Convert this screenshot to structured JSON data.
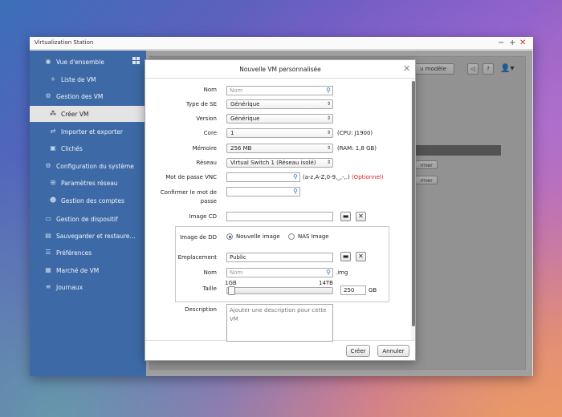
{
  "window": {
    "title": "Virtualization Station"
  },
  "sidebar": {
    "items": [
      {
        "label": "Vue d'ensemble",
        "icon": "circle-info-icon"
      },
      {
        "label": "Liste de VM",
        "icon": "plus-icon"
      },
      {
        "label": "Gestion des VM",
        "icon": "gear-icon"
      },
      {
        "label": "Créer VM",
        "icon": "cluster-icon"
      },
      {
        "label": "Importer et exporter",
        "icon": "import-export-icon"
      },
      {
        "label": "Clichés",
        "icon": "camera-icon"
      },
      {
        "label": "Configuration du système",
        "icon": "settings-icon"
      },
      {
        "label": "Paramètres réseau",
        "icon": "network-icon"
      },
      {
        "label": "Gestion des comptes",
        "icon": "users-icon"
      },
      {
        "label": "Gestion de dispositif",
        "icon": "device-icon"
      },
      {
        "label": "Sauvegarder et restaure...",
        "icon": "backup-icon"
      },
      {
        "label": "Préférences",
        "icon": "preferences-icon"
      },
      {
        "label": "Marché de VM",
        "icon": "market-icon"
      },
      {
        "label": "Journaux",
        "icon": "log-icon"
      }
    ],
    "active_index": 3
  },
  "main": {
    "template_button": "u modèle",
    "fragment_button": "rmer"
  },
  "dialog": {
    "title": "Nouvelle VM personnalisée",
    "fields": {
      "nom": {
        "label": "Nom",
        "placeholder": "Nom"
      },
      "type_se": {
        "label": "Type de SE",
        "value": "Générique"
      },
      "version": {
        "label": "Version",
        "value": "Générique"
      },
      "core": {
        "label": "Core",
        "value": "1",
        "note": "(CPU: J1900)"
      },
      "memoire": {
        "label": "Mémoire",
        "value": "256 MB",
        "note": "(RAM: 1,8 GB)"
      },
      "reseau": {
        "label": "Réseau",
        "value": "Virtual Switch 1 (Réseau isolé)"
      },
      "vnc": {
        "label": "Mot de passe VNC",
        "note": "(a-z,A-Z,0-9,_,-,.)",
        "optional": "(Optionnel)"
      },
      "confirm": {
        "label": "Confirmer le mot de passe"
      },
      "image_cd": {
        "label": "Image CD"
      },
      "image_dd": {
        "label": "Image de DD",
        "option1": "Nouvelle image",
        "option2": "NAS Image",
        "selected": "Nouvelle image"
      },
      "emplacement": {
        "label": "Emplacement",
        "value": "Public"
      },
      "disk_name": {
        "label": "Nom",
        "placeholder": "Nom",
        "suffix": ".img"
      },
      "taille": {
        "label": "Taille",
        "min": "1GB",
        "max": "14TB",
        "value": "250",
        "unit": "GB",
        "level": 0.017
      },
      "description": {
        "label": "Description",
        "placeholder": "Ajouter une description pour cette VM"
      }
    },
    "buttons": {
      "create": "Créer",
      "cancel": "Annuler"
    }
  }
}
